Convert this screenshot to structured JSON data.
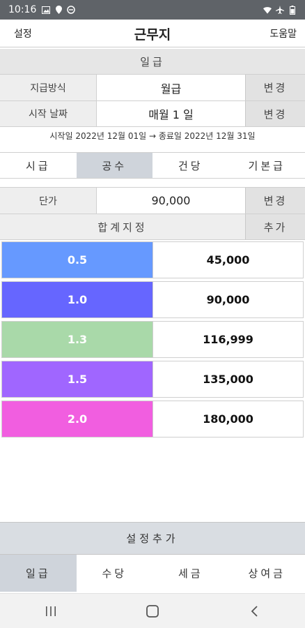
{
  "status": {
    "time": "10:16"
  },
  "appbar": {
    "left_label": "설정",
    "title": "근무지",
    "right_label": "도움말"
  },
  "wage_section": {
    "title": "일급"
  },
  "pay_method": {
    "label": "지급방식",
    "value": "월급",
    "button": "변경"
  },
  "start_date": {
    "label": "시작 날짜",
    "value": "매월 1 일",
    "button": "변경"
  },
  "date_range": "시작일 2022년 12월 01일 → 종료일 2022년 12월 31일",
  "pay_tabs": [
    {
      "label": "시급",
      "active": false
    },
    {
      "label": "공수",
      "active": true
    },
    {
      "label": "건당",
      "active": false
    },
    {
      "label": "기본급",
      "active": false
    }
  ],
  "unit_price": {
    "label": "단가",
    "value": "90,000",
    "button": "변경"
  },
  "total": {
    "label": "합계지정",
    "button": "추가"
  },
  "rates": [
    {
      "multiplier": "0.5",
      "amount": "45,000",
      "color": "#6699ff"
    },
    {
      "multiplier": "1.0",
      "amount": "90,000",
      "color": "#6666ff"
    },
    {
      "multiplier": "1.3",
      "amount": "116,999",
      "color": "#a9d9a9"
    },
    {
      "multiplier": "1.5",
      "amount": "135,000",
      "color": "#a066ff"
    },
    {
      "multiplier": "2.0",
      "amount": "180,000",
      "color": "#f15ee0"
    }
  ],
  "settings_add": "설정추가",
  "bottom_tabs": [
    {
      "label": "일급",
      "active": true
    },
    {
      "label": "수당",
      "active": false
    },
    {
      "label": "세금",
      "active": false
    },
    {
      "label": "상여금",
      "active": false
    }
  ],
  "navbar": {
    "icons": [
      "recent-apps-icon",
      "home-icon",
      "back-icon"
    ]
  }
}
